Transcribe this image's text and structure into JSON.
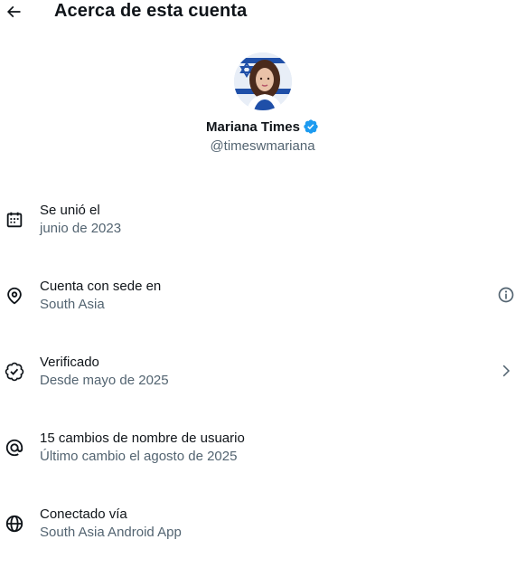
{
  "header": {
    "title": "Acerca de esta cuenta",
    "back_icon": "arrow-left-icon"
  },
  "profile": {
    "display_name": "Mariana Times",
    "handle": "@timeswmariana",
    "verified_color": "#1d9bf0",
    "avatar": "profile-photo"
  },
  "rows": [
    {
      "icon": "calendar-icon",
      "title": "Se unió el",
      "subtitle": "junio de 2023"
    },
    {
      "icon": "location-pin-icon",
      "title": "Cuenta con sede en",
      "subtitle": "South Asia",
      "action_icon": "info-icon"
    },
    {
      "icon": "verified-badge-icon",
      "title": "Verificado",
      "subtitle": "Desde mayo de 2025",
      "action_icon": "chevron-right-icon"
    },
    {
      "icon": "at-sign-icon",
      "title": "15 cambios de nombre de usuario",
      "subtitle": "Último cambio el agosto de 2025"
    },
    {
      "icon": "globe-icon",
      "title": "Conectado vía",
      "subtitle": "South Asia Android App"
    }
  ],
  "colors": {
    "text_primary": "#0f1419",
    "text_secondary": "#536471",
    "accent": "#1d9bf0"
  }
}
